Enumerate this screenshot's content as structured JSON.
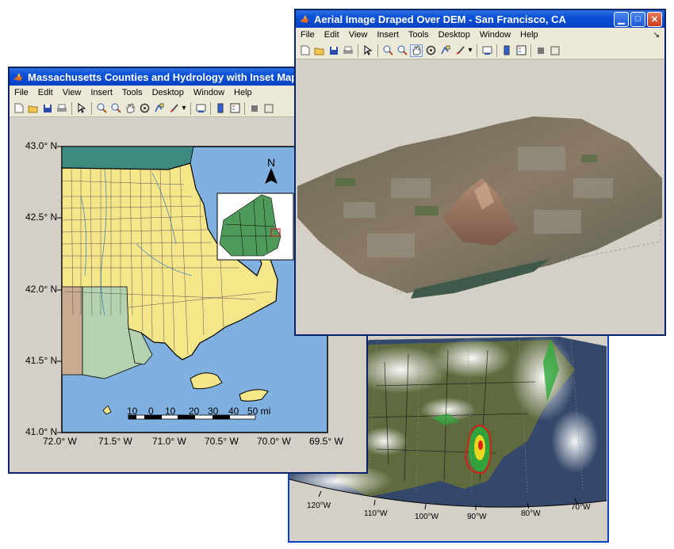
{
  "windows": {
    "weather": {
      "lon_labels": [
        "120°W",
        "110°W",
        "100°W",
        "90°W",
        "80°W",
        "70°W"
      ]
    },
    "massachusetts": {
      "title": "Massachusetts Counties and Hydrology with Inset Map",
      "menu": [
        "File",
        "Edit",
        "View",
        "Insert",
        "Tools",
        "Desktop",
        "Window",
        "Help"
      ],
      "lat_labels": [
        "43.0° N",
        "42.5° N",
        "42.0° N",
        "41.5° N",
        "41.0° N"
      ],
      "lon_labels": [
        "72.0° W",
        "71.5° W",
        "71.0° W",
        "70.5° W",
        "70.0° W",
        "69.5° W"
      ],
      "north_arrow": "N",
      "scalebar_labels": [
        "10",
        "0",
        "10",
        "20",
        "30",
        "40",
        "50 mi"
      ],
      "colors": {
        "ocean": "#7fb0e0",
        "land": "#f5e68a",
        "teal": "#3d8a80",
        "sage": "#b4d2b0",
        "tan": "#c8ab90"
      }
    },
    "sanfrancisco": {
      "title": "Aerial Image Draped Over DEM - San Francisco, CA",
      "menu": [
        "File",
        "Edit",
        "View",
        "Insert",
        "Tools",
        "Desktop",
        "Window",
        "Help"
      ],
      "dock_arrow": "↘"
    }
  },
  "icons": [
    "matlab-logo-icon",
    "new-file-icon",
    "open-folder-icon",
    "save-icon",
    "print-icon",
    "pointer-icon",
    "zoom-in-icon",
    "zoom-out-icon",
    "pan-hand-icon",
    "rotate-3d-icon",
    "data-cursor-icon",
    "brush-icon",
    "link-icon",
    "colorbar-icon",
    "legend-icon",
    "hide-tools-icon",
    "show-tools-icon",
    "minimize-icon",
    "maximize-icon",
    "close-icon"
  ]
}
